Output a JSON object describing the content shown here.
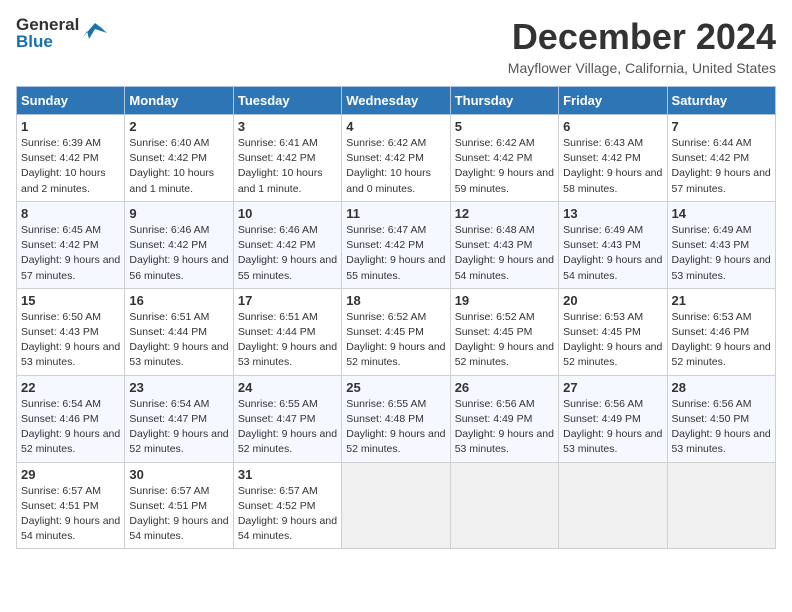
{
  "header": {
    "logo_general": "General",
    "logo_blue": "Blue",
    "month_title": "December 2024",
    "location": "Mayflower Village, California, United States"
  },
  "days_of_week": [
    "Sunday",
    "Monday",
    "Tuesday",
    "Wednesday",
    "Thursday",
    "Friday",
    "Saturday"
  ],
  "weeks": [
    [
      {
        "day": "1",
        "sunrise": "Sunrise: 6:39 AM",
        "sunset": "Sunset: 4:42 PM",
        "daylight": "Daylight: 10 hours and 2 minutes."
      },
      {
        "day": "2",
        "sunrise": "Sunrise: 6:40 AM",
        "sunset": "Sunset: 4:42 PM",
        "daylight": "Daylight: 10 hours and 1 minute."
      },
      {
        "day": "3",
        "sunrise": "Sunrise: 6:41 AM",
        "sunset": "Sunset: 4:42 PM",
        "daylight": "Daylight: 10 hours and 1 minute."
      },
      {
        "day": "4",
        "sunrise": "Sunrise: 6:42 AM",
        "sunset": "Sunset: 4:42 PM",
        "daylight": "Daylight: 10 hours and 0 minutes."
      },
      {
        "day": "5",
        "sunrise": "Sunrise: 6:42 AM",
        "sunset": "Sunset: 4:42 PM",
        "daylight": "Daylight: 9 hours and 59 minutes."
      },
      {
        "day": "6",
        "sunrise": "Sunrise: 6:43 AM",
        "sunset": "Sunset: 4:42 PM",
        "daylight": "Daylight: 9 hours and 58 minutes."
      },
      {
        "day": "7",
        "sunrise": "Sunrise: 6:44 AM",
        "sunset": "Sunset: 4:42 PM",
        "daylight": "Daylight: 9 hours and 57 minutes."
      }
    ],
    [
      {
        "day": "8",
        "sunrise": "Sunrise: 6:45 AM",
        "sunset": "Sunset: 4:42 PM",
        "daylight": "Daylight: 9 hours and 57 minutes."
      },
      {
        "day": "9",
        "sunrise": "Sunrise: 6:46 AM",
        "sunset": "Sunset: 4:42 PM",
        "daylight": "Daylight: 9 hours and 56 minutes."
      },
      {
        "day": "10",
        "sunrise": "Sunrise: 6:46 AM",
        "sunset": "Sunset: 4:42 PM",
        "daylight": "Daylight: 9 hours and 55 minutes."
      },
      {
        "day": "11",
        "sunrise": "Sunrise: 6:47 AM",
        "sunset": "Sunset: 4:42 PM",
        "daylight": "Daylight: 9 hours and 55 minutes."
      },
      {
        "day": "12",
        "sunrise": "Sunrise: 6:48 AM",
        "sunset": "Sunset: 4:43 PM",
        "daylight": "Daylight: 9 hours and 54 minutes."
      },
      {
        "day": "13",
        "sunrise": "Sunrise: 6:49 AM",
        "sunset": "Sunset: 4:43 PM",
        "daylight": "Daylight: 9 hours and 54 minutes."
      },
      {
        "day": "14",
        "sunrise": "Sunrise: 6:49 AM",
        "sunset": "Sunset: 4:43 PM",
        "daylight": "Daylight: 9 hours and 53 minutes."
      }
    ],
    [
      {
        "day": "15",
        "sunrise": "Sunrise: 6:50 AM",
        "sunset": "Sunset: 4:43 PM",
        "daylight": "Daylight: 9 hours and 53 minutes."
      },
      {
        "day": "16",
        "sunrise": "Sunrise: 6:51 AM",
        "sunset": "Sunset: 4:44 PM",
        "daylight": "Daylight: 9 hours and 53 minutes."
      },
      {
        "day": "17",
        "sunrise": "Sunrise: 6:51 AM",
        "sunset": "Sunset: 4:44 PM",
        "daylight": "Daylight: 9 hours and 53 minutes."
      },
      {
        "day": "18",
        "sunrise": "Sunrise: 6:52 AM",
        "sunset": "Sunset: 4:45 PM",
        "daylight": "Daylight: 9 hours and 52 minutes."
      },
      {
        "day": "19",
        "sunrise": "Sunrise: 6:52 AM",
        "sunset": "Sunset: 4:45 PM",
        "daylight": "Daylight: 9 hours and 52 minutes."
      },
      {
        "day": "20",
        "sunrise": "Sunrise: 6:53 AM",
        "sunset": "Sunset: 4:45 PM",
        "daylight": "Daylight: 9 hours and 52 minutes."
      },
      {
        "day": "21",
        "sunrise": "Sunrise: 6:53 AM",
        "sunset": "Sunset: 4:46 PM",
        "daylight": "Daylight: 9 hours and 52 minutes."
      }
    ],
    [
      {
        "day": "22",
        "sunrise": "Sunrise: 6:54 AM",
        "sunset": "Sunset: 4:46 PM",
        "daylight": "Daylight: 9 hours and 52 minutes."
      },
      {
        "day": "23",
        "sunrise": "Sunrise: 6:54 AM",
        "sunset": "Sunset: 4:47 PM",
        "daylight": "Daylight: 9 hours and 52 minutes."
      },
      {
        "day": "24",
        "sunrise": "Sunrise: 6:55 AM",
        "sunset": "Sunset: 4:47 PM",
        "daylight": "Daylight: 9 hours and 52 minutes."
      },
      {
        "day": "25",
        "sunrise": "Sunrise: 6:55 AM",
        "sunset": "Sunset: 4:48 PM",
        "daylight": "Daylight: 9 hours and 52 minutes."
      },
      {
        "day": "26",
        "sunrise": "Sunrise: 6:56 AM",
        "sunset": "Sunset: 4:49 PM",
        "daylight": "Daylight: 9 hours and 53 minutes."
      },
      {
        "day": "27",
        "sunrise": "Sunrise: 6:56 AM",
        "sunset": "Sunset: 4:49 PM",
        "daylight": "Daylight: 9 hours and 53 minutes."
      },
      {
        "day": "28",
        "sunrise": "Sunrise: 6:56 AM",
        "sunset": "Sunset: 4:50 PM",
        "daylight": "Daylight: 9 hours and 53 minutes."
      }
    ],
    [
      {
        "day": "29",
        "sunrise": "Sunrise: 6:57 AM",
        "sunset": "Sunset: 4:51 PM",
        "daylight": "Daylight: 9 hours and 54 minutes."
      },
      {
        "day": "30",
        "sunrise": "Sunrise: 6:57 AM",
        "sunset": "Sunset: 4:51 PM",
        "daylight": "Daylight: 9 hours and 54 minutes."
      },
      {
        "day": "31",
        "sunrise": "Sunrise: 6:57 AM",
        "sunset": "Sunset: 4:52 PM",
        "daylight": "Daylight: 9 hours and 54 minutes."
      },
      null,
      null,
      null,
      null
    ]
  ]
}
